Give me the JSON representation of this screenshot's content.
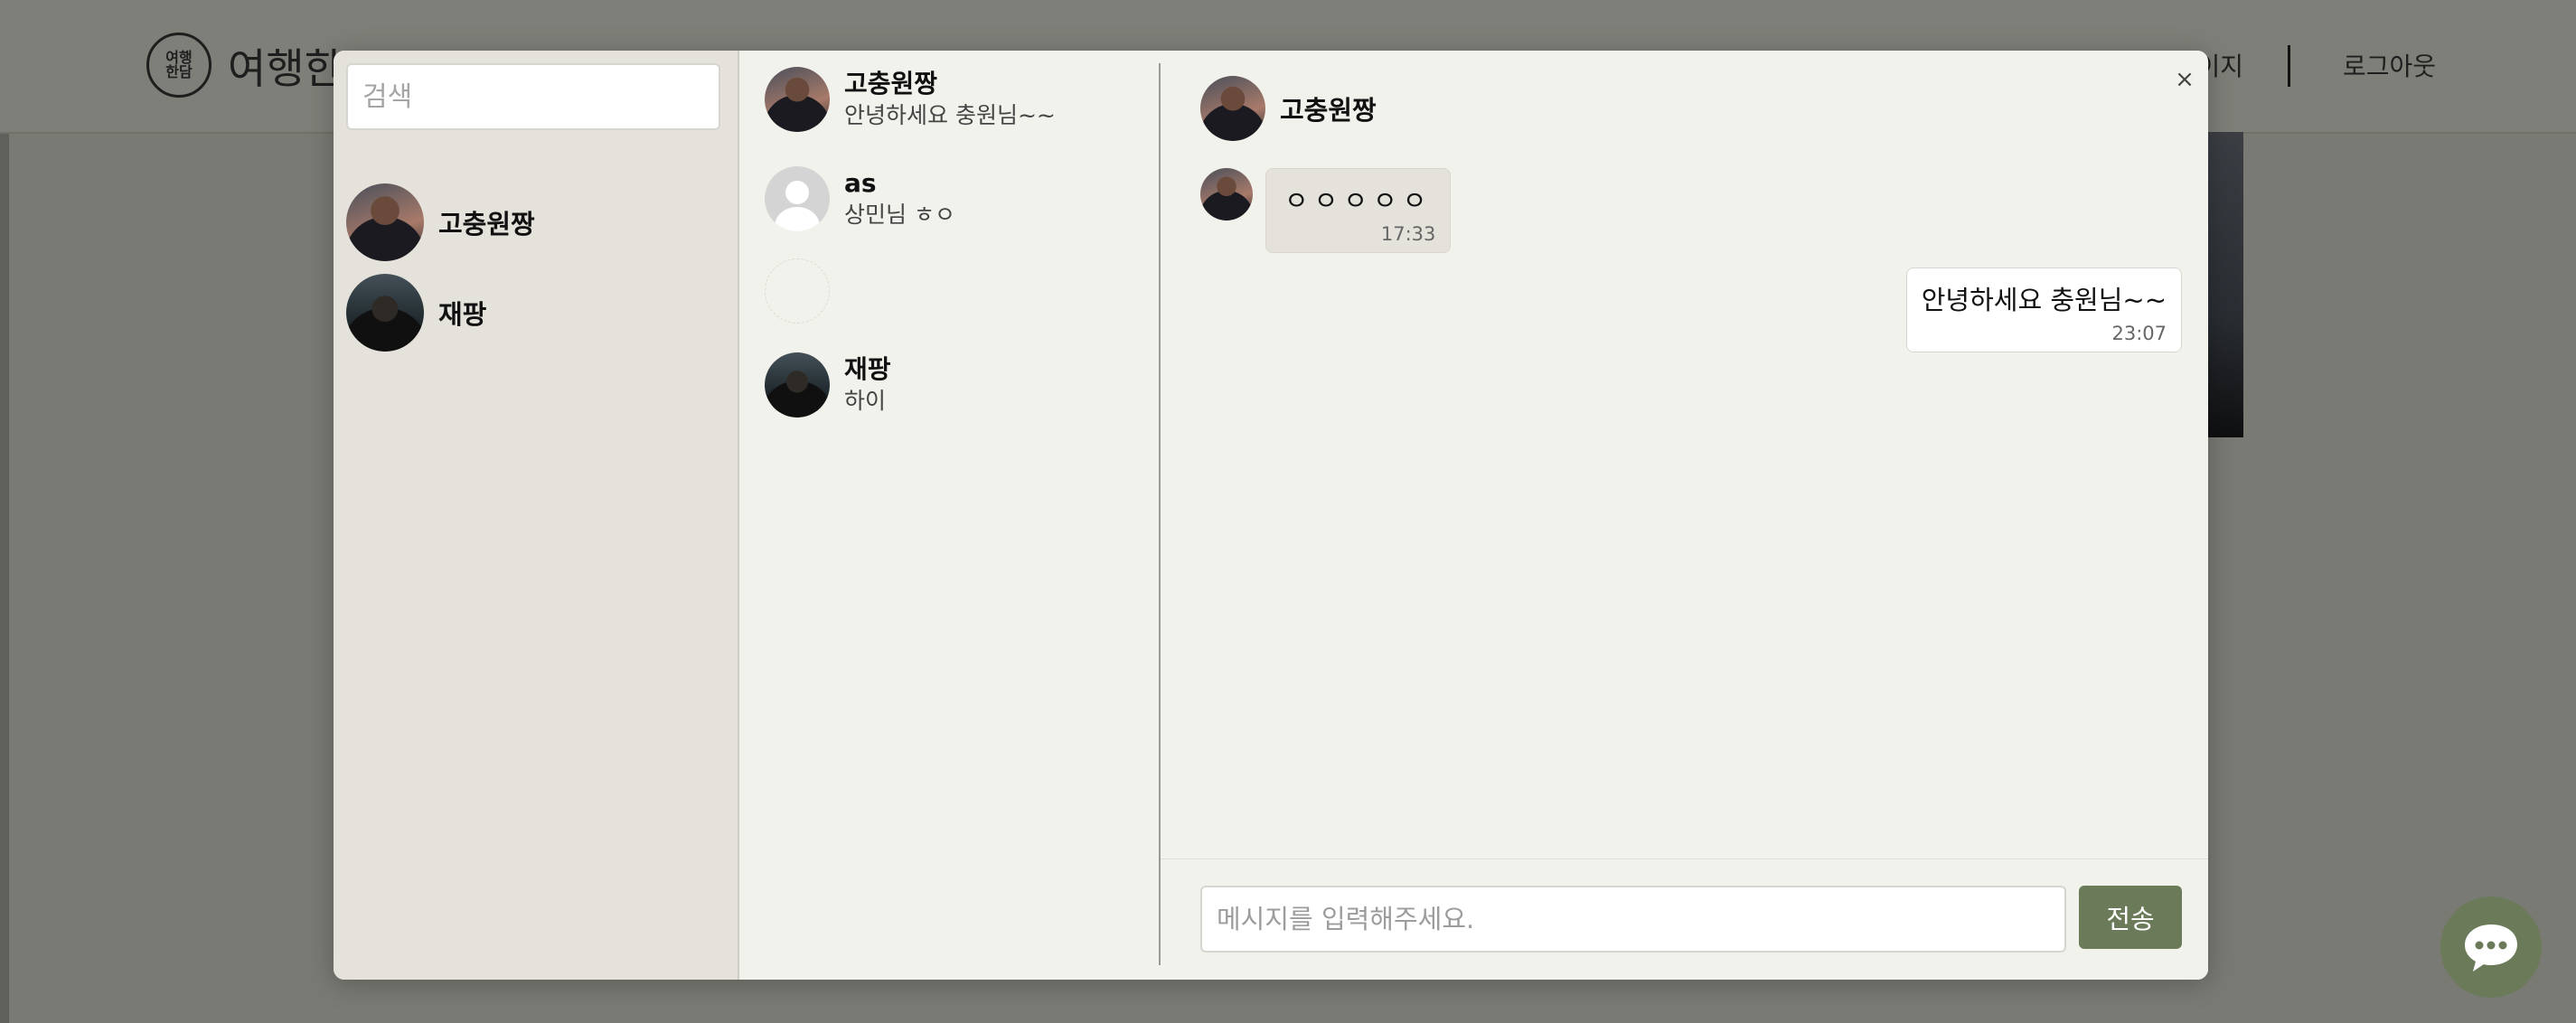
{
  "site": {
    "logo_text": "여행\n한담",
    "name": "여행한담"
  },
  "nav": {
    "items": [
      "마이페이지",
      "로그아웃"
    ]
  },
  "friends": {
    "search_placeholder": "검색",
    "list": [
      {
        "name": "고충원짱"
      },
      {
        "name": "재팡"
      }
    ]
  },
  "rooms": [
    {
      "name": "고충원짱",
      "last_message": "안녕하세요 충원님~~"
    },
    {
      "name": "as",
      "last_message": "상민님 ㅎㅇ"
    },
    {
      "name": "",
      "last_message": ""
    },
    {
      "name": "재팡",
      "last_message": "하이"
    }
  ],
  "chat": {
    "partner_name": "고충원짱",
    "close_label": "×",
    "messages": [
      {
        "direction": "in",
        "text": "ㅇㅇㅇㅇㅇ",
        "time": "17:33"
      },
      {
        "direction": "out",
        "text": "안녕하세요 충원님~~",
        "time": "23:07"
      }
    ],
    "input_placeholder": "메시지를 입력해주세요.",
    "send_label": "전송"
  },
  "colors": {
    "accent": "#6b7b5a",
    "modal_bg": "#f2f2ec",
    "friends_bg": "#e4e2db"
  },
  "icons": {
    "fab": "chat-bubble-icon",
    "close": "close-icon"
  }
}
